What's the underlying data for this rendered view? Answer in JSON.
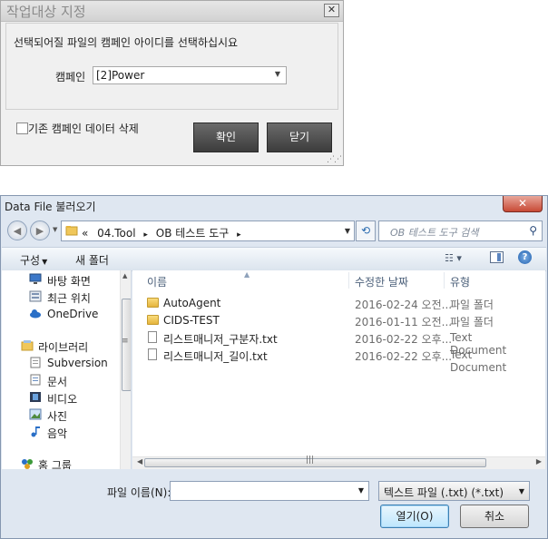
{
  "dialog1": {
    "title": "작업대상 지정",
    "close_glyph": "✕",
    "message": "선택되어질 파일의 캠페인 아이디를 선택하십시요",
    "campaign_label": "캠페인",
    "campaign_value": "[2]Power",
    "checkbox_label": "기존 캠페인 데이터 삭제",
    "ok_label": "확인",
    "close_label": "닫기"
  },
  "dialog2": {
    "title": "Data File 불러오기",
    "close_glyph": "✕",
    "address": {
      "prefix": "«",
      "crumbs": [
        "04.Tool",
        "OB 테스트 도구"
      ],
      "separator": "▸"
    },
    "search_placeholder": "OB 테스트 도구 검색",
    "toolbar": {
      "organize": "구성",
      "new_folder": "새 폴더"
    },
    "nav": [
      {
        "label": "바탕 화면",
        "icon": "desktop-icon"
      },
      {
        "label": "최근 위치",
        "icon": "recent-places-icon"
      },
      {
        "label": "OneDrive",
        "icon": "cloud-icon"
      },
      {
        "label": "라이브러리",
        "icon": "library-icon"
      },
      {
        "label": "Subversion",
        "icon": "subversion-icon"
      },
      {
        "label": "문서",
        "icon": "documents-icon"
      },
      {
        "label": "비디오",
        "icon": "video-icon"
      },
      {
        "label": "사진",
        "icon": "pictures-icon"
      },
      {
        "label": "음악",
        "icon": "music-icon"
      },
      {
        "label": "홈 그룹",
        "icon": "homegroup-icon"
      }
    ],
    "columns": {
      "name": "이름",
      "modified": "수정한 날짜",
      "type": "유형"
    },
    "files": [
      {
        "name": "AutoAgent",
        "modified": "2016-02-24 오전...",
        "type": "파일 폴더",
        "kind": "folder"
      },
      {
        "name": "CIDS-TEST",
        "modified": "2016-01-11 오전...",
        "type": "파일 폴더",
        "kind": "folder"
      },
      {
        "name": "리스트매니저_구분자.txt",
        "modified": "2016-02-22 오후...",
        "type": "Text Document",
        "kind": "text"
      },
      {
        "name": "리스트매니저_길이.txt",
        "modified": "2016-02-22 오후...",
        "type": "Text Document",
        "kind": "text"
      }
    ],
    "filename_label": "파일 이름(N):",
    "filename_value": "",
    "filetype_value": "텍스트 파일 (.txt) (*.txt)",
    "open_label": "열기(O)",
    "cancel_label": "취소"
  }
}
